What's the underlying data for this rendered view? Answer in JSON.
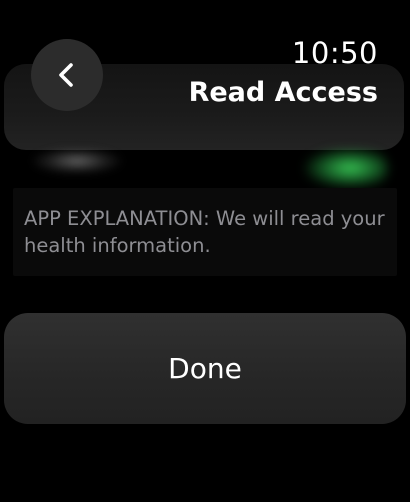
{
  "header": {
    "time": "10:50",
    "title": "Read Access",
    "back_icon": "chevron-left-icon"
  },
  "explanation": {
    "text": "APP EXPLANATION: We will read your health information."
  },
  "actions": {
    "done_label": "Done"
  },
  "colors": {
    "background": "#000000",
    "button_fill": "#2c2c2c",
    "secondary_text": "#8e8e93",
    "accent_green": "#34c759"
  }
}
